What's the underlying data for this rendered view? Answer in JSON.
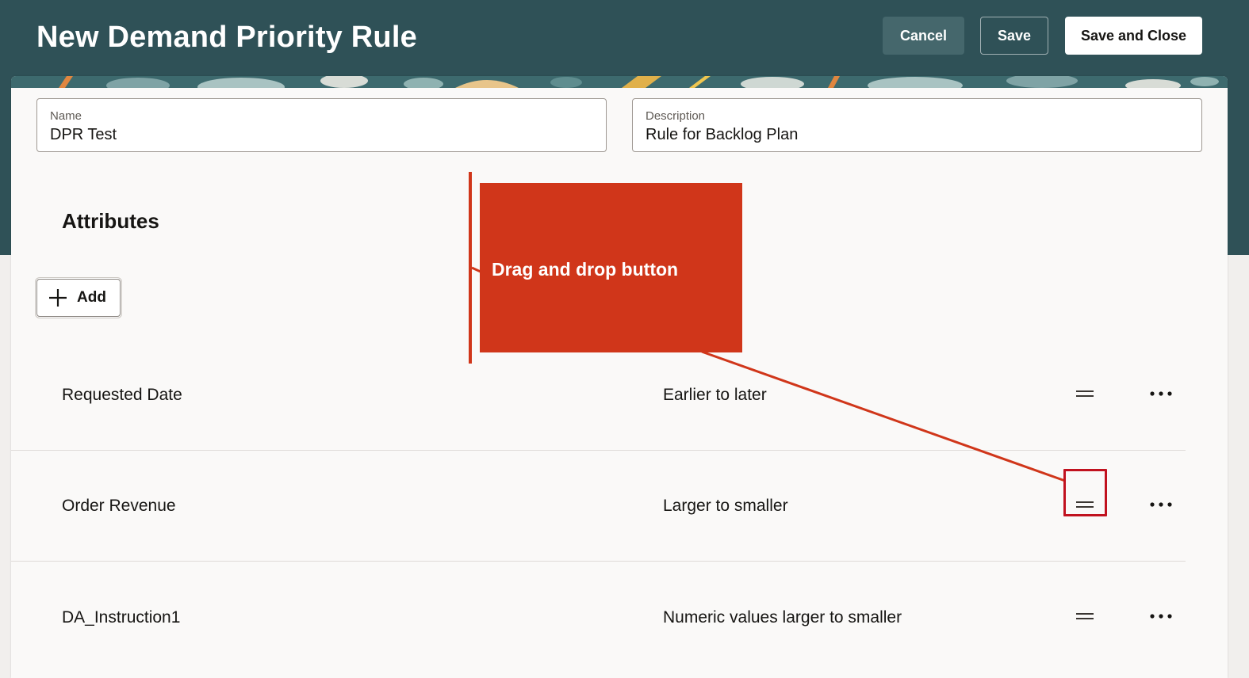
{
  "header": {
    "title": "New Demand Priority Rule",
    "cancel_label": "Cancel",
    "save_label": "Save",
    "save_close_label": "Save and Close"
  },
  "form": {
    "name_label": "Name",
    "name_value": "DPR Test",
    "description_label": "Description",
    "description_value": "Rule for Backlog Plan"
  },
  "attributes": {
    "title": "Attributes",
    "add_label": "Add",
    "rows": [
      {
        "name": "Requested Date",
        "order": "Earlier to later"
      },
      {
        "name": "Order Revenue",
        "order": "Larger to smaller"
      },
      {
        "name": "DA_Instruction1",
        "order": "Numeric values larger to smaller"
      }
    ]
  },
  "callout": {
    "text": "Drag and drop button"
  },
  "colors": {
    "header_bg": "#2f5157",
    "callout": "#d0361a",
    "highlight": "#c1121f",
    "card_bg": "#faf9f8"
  },
  "icons": {
    "add": "plus-icon",
    "reorder": "drag-handle-icon",
    "actions": "more-horizontal-icon"
  }
}
